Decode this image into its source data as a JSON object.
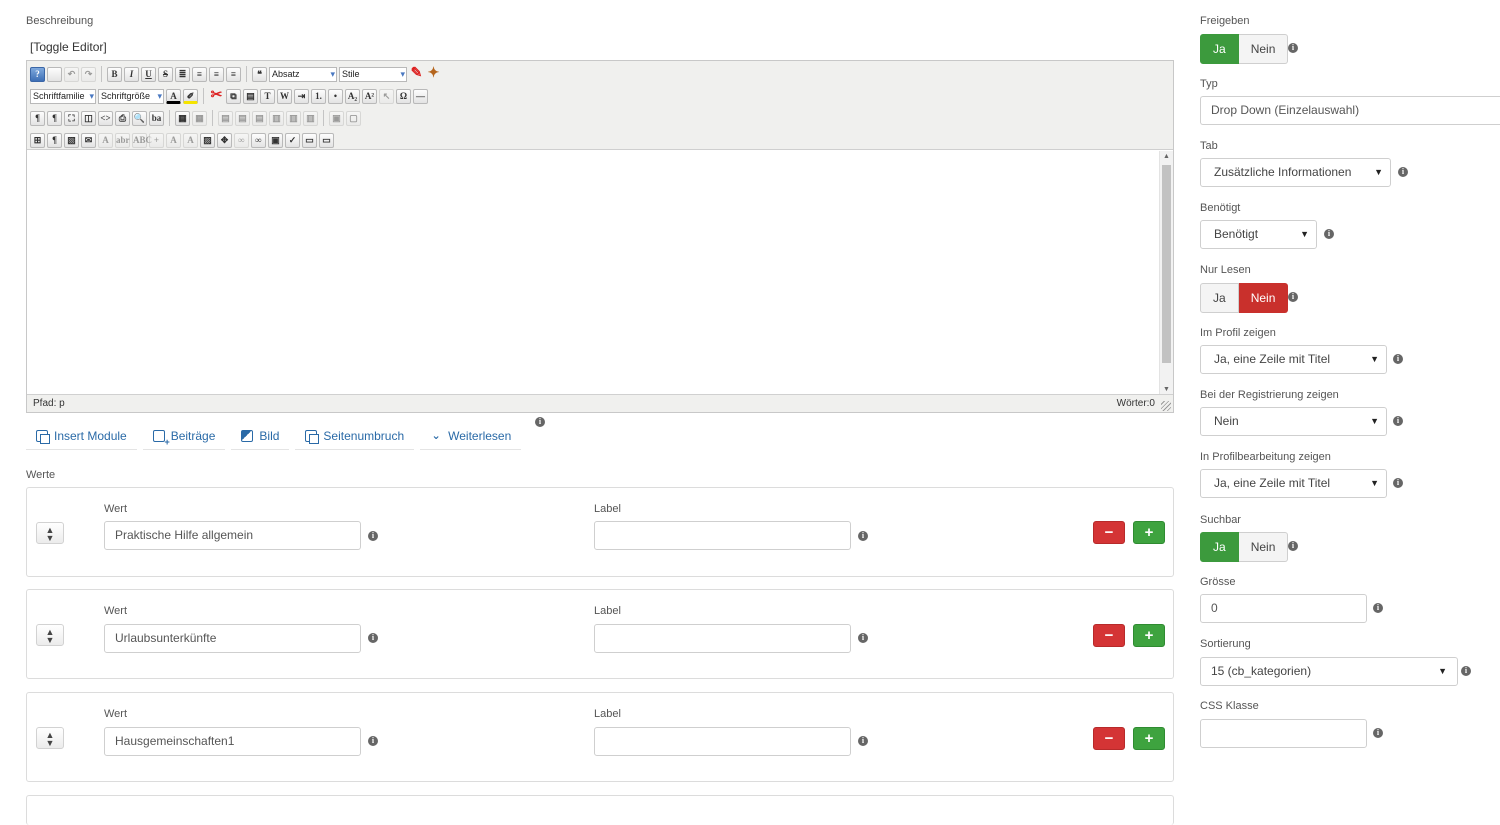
{
  "description": {
    "label": "Beschreibung",
    "toggle_editor": "[Toggle Editor]",
    "toolbar": {
      "format_select": "Absatz",
      "style_select": "Stile",
      "font_family": "Schriftfamilie",
      "font_size": "Schriftgröße"
    },
    "status_path": "Pfad: p",
    "word_count": "Wörter:0"
  },
  "editor_buttons": [
    {
      "label": "Insert Module",
      "icon": "module-icon"
    },
    {
      "label": "Beiträge",
      "icon": "article-icon"
    },
    {
      "label": "Bild",
      "icon": "image-icon"
    },
    {
      "label": "Seitenumbruch",
      "icon": "pagebreak-icon"
    },
    {
      "label": "Weiterlesen",
      "icon": "chevron-down-icon"
    }
  ],
  "values": {
    "label": "Werte",
    "value_label": "Wert",
    "label_label": "Label",
    "rows": [
      {
        "value": "Praktische Hilfe allgemein",
        "label": ""
      },
      {
        "value": "Urlaubsunterkünfte",
        "label": ""
      },
      {
        "value": "Hausgemeinschaften1",
        "label": ""
      }
    ]
  },
  "settings": {
    "freigeben": {
      "label": "Freigeben",
      "yes": "Ja",
      "no": "Nein",
      "selected": "Ja"
    },
    "typ": {
      "label": "Typ",
      "value": "Drop Down (Einzelauswahl)"
    },
    "tab": {
      "label": "Tab",
      "value": "Zusätzliche Informationen"
    },
    "benoetigt": {
      "label": "Benötigt",
      "value": "Benötigt"
    },
    "nur_lesen": {
      "label": "Nur Lesen",
      "yes": "Ja",
      "no": "Nein",
      "selected": "Nein"
    },
    "im_profil": {
      "label": "Im Profil zeigen",
      "value": "Ja, eine Zeile mit Titel"
    },
    "registrierung": {
      "label": "Bei der Registrierung zeigen",
      "value": "Nein"
    },
    "profilbearbeitung": {
      "label": "In Profilbearbeitung zeigen",
      "value": "Ja, eine Zeile mit Titel"
    },
    "suchbar": {
      "label": "Suchbar",
      "yes": "Ja",
      "no": "Nein",
      "selected": "Ja"
    },
    "groesse": {
      "label": "Grösse",
      "value": "0"
    },
    "sortierung": {
      "label": "Sortierung",
      "value": "15 (cb_kategorien)"
    },
    "css_klasse": {
      "label": "CSS Klasse",
      "value": ""
    }
  },
  "colors": {
    "green": "#3c9a3d",
    "red": "#c9302c",
    "link": "#2a6aa7"
  }
}
